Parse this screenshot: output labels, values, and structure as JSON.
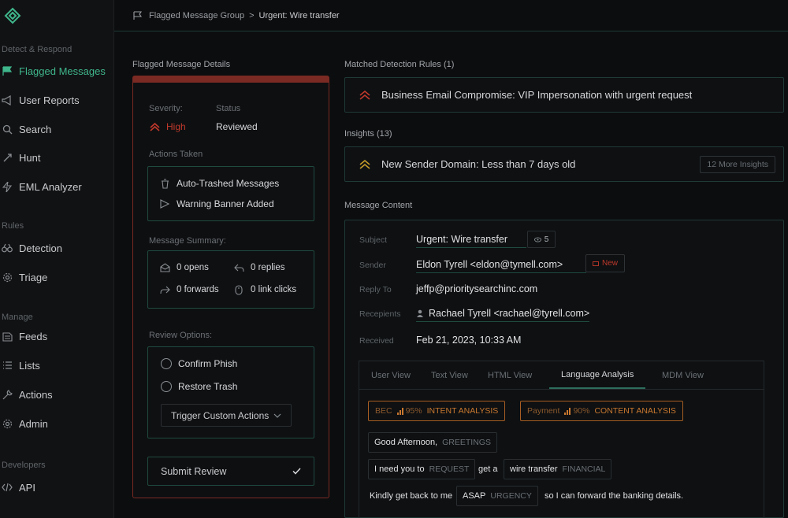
{
  "sidebar": {
    "sections": {
      "detect": "Detect & Respond",
      "rules": "Rules",
      "manage": "Manage",
      "developers": "Developers"
    },
    "items": [
      {
        "label": "Flagged Messages",
        "icon": "flag-icon",
        "active": true
      },
      {
        "label": "User Reports",
        "icon": "megaphone-icon"
      },
      {
        "label": "Search",
        "icon": "search-icon"
      },
      {
        "label": "Hunt",
        "icon": "crosshair-icon"
      },
      {
        "label": "EML Analyzer",
        "icon": "bolt-icon"
      },
      {
        "label": "Detection",
        "icon": "binoculars-icon"
      },
      {
        "label": "Triage",
        "icon": "gear-icon"
      },
      {
        "label": "Feeds",
        "icon": "rss-icon"
      },
      {
        "label": "Lists",
        "icon": "list-icon"
      },
      {
        "label": "Actions",
        "icon": "wrench-icon"
      },
      {
        "label": "Admin",
        "icon": "cog-icon"
      },
      {
        "label": "API",
        "icon": "code-icon"
      }
    ]
  },
  "breadcrumb": {
    "parent": "Flagged Message Group",
    "separator": ">",
    "current": "Urgent: Wire transfer"
  },
  "details": {
    "heading": "Flagged Message Details",
    "severity_label": "Severity:",
    "severity_value": "High",
    "status_label": "Status",
    "status_value": "Reviewed",
    "actions_label": "Actions Taken",
    "actions": [
      "Auto-Trashed Messages",
      "Warning Banner Added"
    ],
    "summary_label": "Message Summary:",
    "summary": {
      "opens": "0 opens",
      "replies": "0 replies",
      "forwards": "0 forwards",
      "link_clicks": "0 link clicks"
    },
    "review_label": "Review Options:",
    "review_options": [
      "Confirm Phish",
      "Restore Trash"
    ],
    "trigger_label": "Trigger Custom Actions",
    "submit_label": "Submit Review"
  },
  "rules": {
    "heading": "Matched Detection Rules (1)",
    "items": [
      "Business Email Compromise: VIP Impersonation with urgent request"
    ]
  },
  "insights": {
    "heading": "Insights (13)",
    "first": "New Sender Domain: Less than 7 days old",
    "more_label": "12 More Insights"
  },
  "message": {
    "heading": "Message Content",
    "subject_label": "Subject",
    "subject": "Urgent: Wire transfer",
    "subject_count": "5",
    "sender_label": "Sender",
    "sender": "Eldon Tyrell <eldon@tymell.com>",
    "sender_badge": "New",
    "reply_to_label": "Reply To",
    "reply_to": "jeffp@prioritysearchinc.com",
    "recipients_label": "Recepients",
    "recipients": "Rachael Tyrell <rachael@tyrell.com>",
    "received_label": "Received",
    "received": "Feb 21, 2023, 10:33 AM"
  },
  "tabs": [
    "User View",
    "Text View",
    "HTML View",
    "Language Analysis",
    "MDM View"
  ],
  "language": {
    "chips": [
      {
        "tag": "BEC",
        "score": "95%",
        "label": "INTENT ANALYSIS"
      },
      {
        "tag": "Payment",
        "score": "90%",
        "label": "CONTENT ANALYSIS"
      }
    ],
    "greeting": {
      "text": "Good Afternoon,",
      "cat": "GREETINGS"
    },
    "line2": {
      "tok1_text": "I need you to",
      "tok1_cat": "REQUEST",
      "mid": "get a",
      "tok2_text": "wire transfer",
      "tok2_cat": "FINANCIAL"
    },
    "line3": {
      "pre": "Kindly get back to me",
      "tok_text": "ASAP",
      "tok_cat": "URGENCY",
      "post": "so I can forward the banking details."
    }
  },
  "colors": {
    "accent": "#3fb68b",
    "danger": "#c0392b",
    "warning": "#c9782f"
  }
}
